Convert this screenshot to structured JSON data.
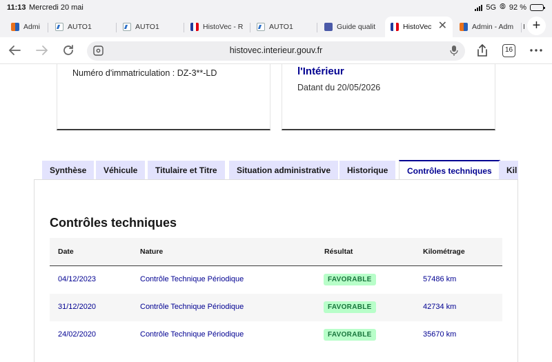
{
  "status_bar": {
    "time": "11:13",
    "date": "Mercredi 20 mai",
    "network": "5G",
    "battery": "92 %",
    "battery_level": 0.92
  },
  "browser_tabs": [
    {
      "title": "Admi",
      "icon": "admin-favicon"
    },
    {
      "title": "AUTO1",
      "icon": "auto1-favicon"
    },
    {
      "title": "AUTO1",
      "icon": "auto1-favicon"
    },
    {
      "title": "HistoVec - R",
      "icon": "french-flag-favicon"
    },
    {
      "title": "AUTO1",
      "icon": "auto1-favicon"
    },
    {
      "title": "Guide qualit",
      "icon": "guide-favicon"
    },
    {
      "title": "HistoVec",
      "icon": "french-flag-favicon",
      "active": true
    },
    {
      "title": "Admin - Adm",
      "icon": "admin-favicon"
    },
    {
      "title": "I",
      "icon": "tab-fragment"
    }
  ],
  "toolbar": {
    "url": "histovec.interieur.gouv.fr",
    "tab_count": "16",
    "close_symbol": "✕",
    "new_tab_symbol": "+"
  },
  "cards": {
    "plate": "Numéro d'immatriculation : DZ-3**-LD",
    "heading": "l'Intérieur",
    "dated": "Datant du 20/05/2026"
  },
  "doc_tabs": [
    {
      "label": "Synthèse"
    },
    {
      "label": "Véhicule"
    },
    {
      "label": "Titulaire et Titre"
    },
    {
      "label": "Situation administrative"
    },
    {
      "label": "Historique"
    },
    {
      "label": "Contrôles techniques",
      "selected": true
    },
    {
      "label": "Kil"
    }
  ],
  "section": {
    "title": "Contrôles techniques",
    "columns": [
      "Date",
      "Nature",
      "Résultat",
      "Kilométrage"
    ],
    "rows": [
      {
        "date": "04/12/2023",
        "nature": "Contrôle Technique Périodique",
        "result": "FAVORABLE",
        "km": "57486 km"
      },
      {
        "date": "31/12/2020",
        "nature": "Contrôle Technique Périodique",
        "result": "FAVORABLE",
        "km": "42734 km"
      },
      {
        "date": "24/02/2020",
        "nature": "Contrôle Technique Périodique",
        "result": "FAVORABLE",
        "km": "35670 km"
      }
    ]
  },
  "colors": {
    "accent": "#000091",
    "tab_bg": "#e3e3fd",
    "badge_bg": "#b8fec9",
    "badge_text": "#18753c"
  }
}
